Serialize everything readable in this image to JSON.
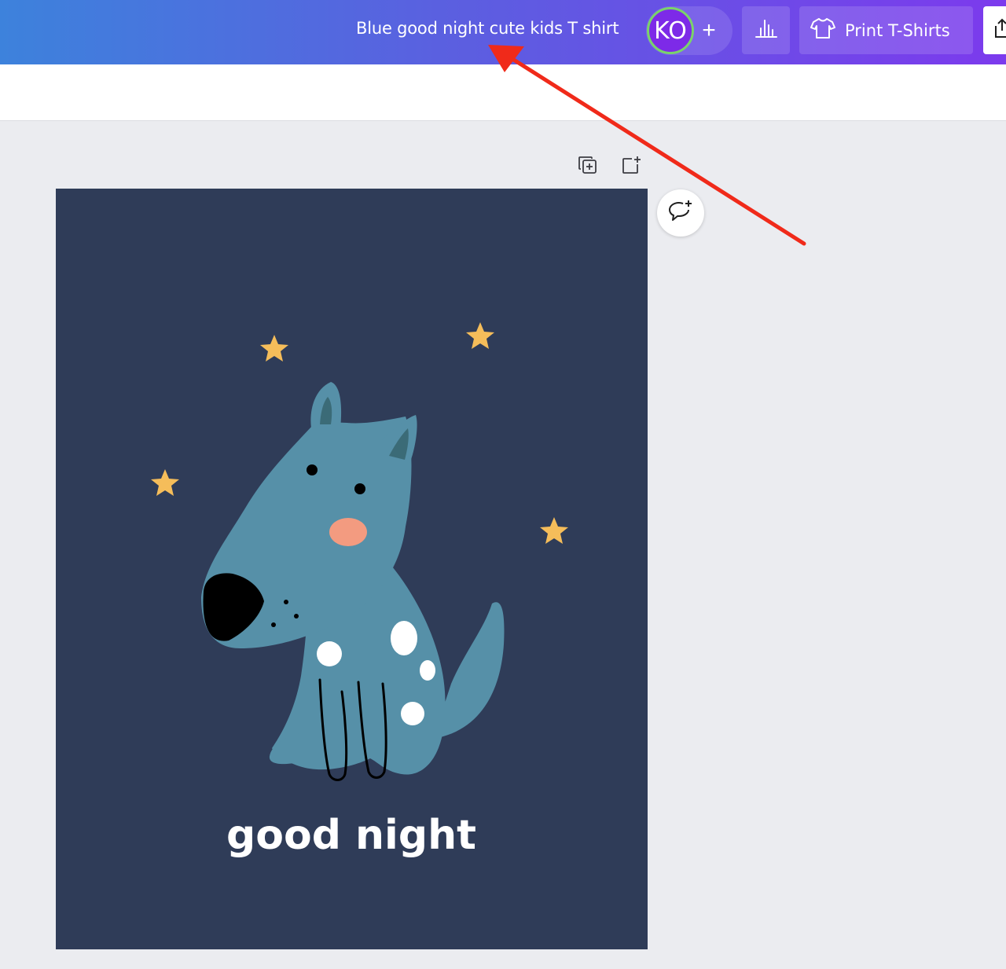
{
  "header": {
    "document_title": "Blue good night cute kids T shirt",
    "avatar_initials": "KO",
    "add_people_glyph": "+",
    "print_label": "Print T-Shirts",
    "icons": {
      "insights": "bar-chart-icon",
      "print": "tshirt-icon",
      "share": "share-icon"
    }
  },
  "page_controls": {
    "icons": [
      "duplicate-page-icon",
      "add-page-icon",
      "add-comment-icon"
    ]
  },
  "design": {
    "text": "good night",
    "colors": {
      "background": "#2f3c58",
      "dog": "#5690a8",
      "ear_inner": "#3b6b77",
      "star": "#f5bd5a",
      "cheek": "#f39b80",
      "nose": "#000000",
      "spots": "#ffffff"
    }
  },
  "annotation": {
    "type": "arrow",
    "color": "#f02a1a",
    "points_to": "document-title"
  }
}
